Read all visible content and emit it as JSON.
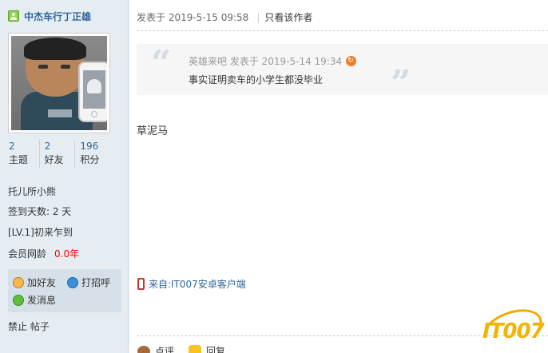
{
  "author": {
    "name": "中杰车行丁正雄"
  },
  "stats": [
    {
      "value": "2",
      "label": "主题"
    },
    {
      "value": "2",
      "label": "好友"
    },
    {
      "value": "196",
      "label": "积分"
    }
  ],
  "profile": {
    "medal": "托儿所小熊",
    "signin": "签到天数: 2 天",
    "level": "[LV.1]初来乍到",
    "membership_label": "会员网龄",
    "membership_value": "0.0年"
  },
  "actions": {
    "add_friend": "加好友",
    "say_hello": "打招呼",
    "send_message": "发消息"
  },
  "banned_text": "禁止 帖子",
  "post": {
    "posted_at": "发表于 2019-5-15 09:58",
    "separator": "|",
    "only_author": "只看该作者",
    "body": "草泥马",
    "source": "来自:IT007安卓客户端"
  },
  "quote": {
    "open_mark": "“",
    "close_mark": "”",
    "meta": "英雄来吧 发表于 2019-5-14 19:34",
    "body": "事实证明卖车的小学生都没毕业"
  },
  "footer": {
    "rate": "点评",
    "reply": "回复"
  },
  "watermark": "IT007",
  "colors": {
    "sidebar_bg": "#e5edf2",
    "link_blue": "#336699",
    "red": "#ff0000",
    "watermark_gold": "#f2b400"
  }
}
